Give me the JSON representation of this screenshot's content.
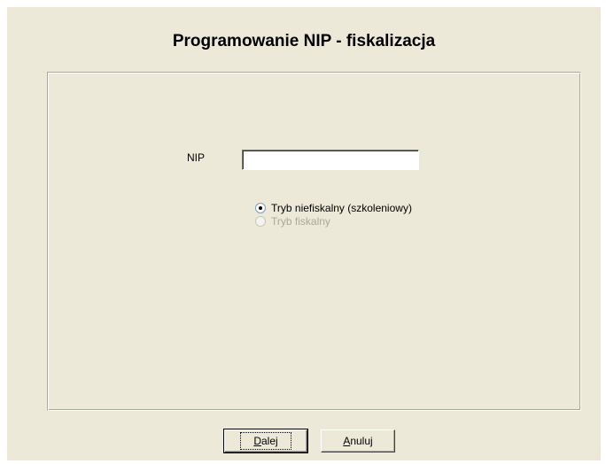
{
  "dialog": {
    "title": "Programowanie NIP - fiskalizacja"
  },
  "form": {
    "nip_label": "NIP",
    "nip_value": "",
    "nip_placeholder": "",
    "mode_options": [
      {
        "label": "Tryb niefiskalny (szkoleniowy)",
        "checked": true,
        "enabled": true
      },
      {
        "label": "Tryb fiskalny",
        "checked": false,
        "enabled": false
      }
    ]
  },
  "buttons": {
    "next": {
      "mnemonic": "D",
      "rest": "alej"
    },
    "cancel": {
      "mnemonic": "A",
      "rest": "nuluj"
    }
  },
  "colors": {
    "dialog_background": "#ece9d8",
    "disabled_text": "#aca899"
  }
}
